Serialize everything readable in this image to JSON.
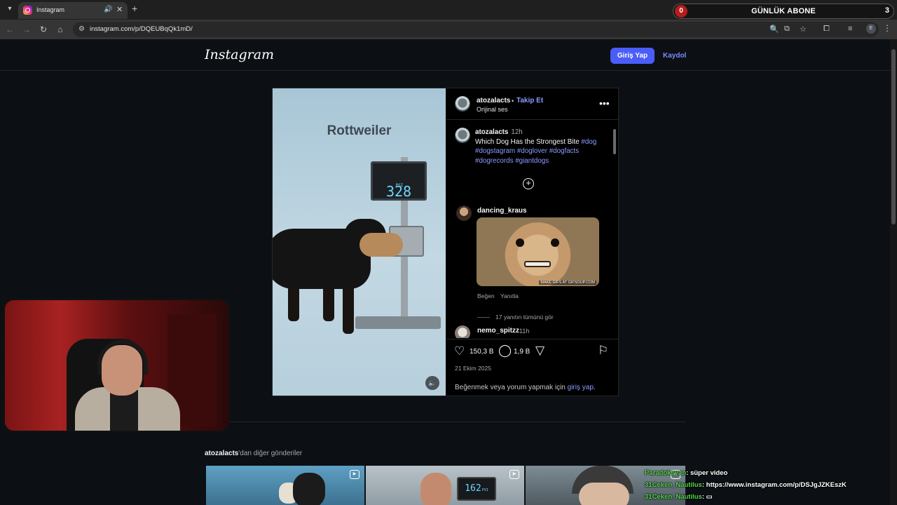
{
  "browser": {
    "tab_title": "Instagram",
    "url": "instagram.com/p/DQEUBqQk1mD/",
    "profile_initial": "E"
  },
  "overlay": {
    "left_count": "0",
    "title": "GÜNLÜK ABONE",
    "right_count": "3"
  },
  "instagram": {
    "logo": "Instagram",
    "login_button": "Giriş Yap",
    "signup_link": "Kaydol"
  },
  "post": {
    "media_title": "Rottweiler",
    "gauge_value": "328",
    "gauge_unit": "PSI",
    "author": "atozalacts",
    "follow_label": "Takip Et",
    "audio_label": "Orijinal ses",
    "caption_author": "atozalacts",
    "caption_time": "12h",
    "caption_text": "Which Dog Has the Strongest Bite",
    "caption_tags": [
      "#dog",
      "#dogstagram",
      "#doglover",
      "#dogfacts",
      "#dogrecords",
      "#giantdogs"
    ],
    "comment1_user": "dancing_kraus",
    "gif_watermark": "MAKE GIFS AT GIFSOUP.COM",
    "like_label": "Beğen",
    "reply_label": "Yanıtla",
    "view_replies": "17 yanıtın tümünü gör",
    "comment2_user": "nemo_spitzz",
    "comment2_time": "11h",
    "likes": "150,3 B",
    "comments_count": "1,9 B",
    "date": "21 Ekim 2025",
    "login_prompt_prefix": "Beğenmek veya yorum yapmak için",
    "login_prompt_link": "giriş yap",
    "login_prompt_suffix": "."
  },
  "more": {
    "author": "atozalacts",
    "suffix": "'dan diğer gönderiler",
    "thumb2_value": "162",
    "thumb2_unit": "PSI"
  },
  "chat": [
    {
      "user": "Paradoksyan",
      "message": "süper video"
    },
    {
      "user": "31Ceken_Nautilus",
      "message": "https://www.instagram.com/p/DSJgJZKEszK"
    },
    {
      "user": "31Ceken_Nautilus",
      "message": ""
    }
  ]
}
